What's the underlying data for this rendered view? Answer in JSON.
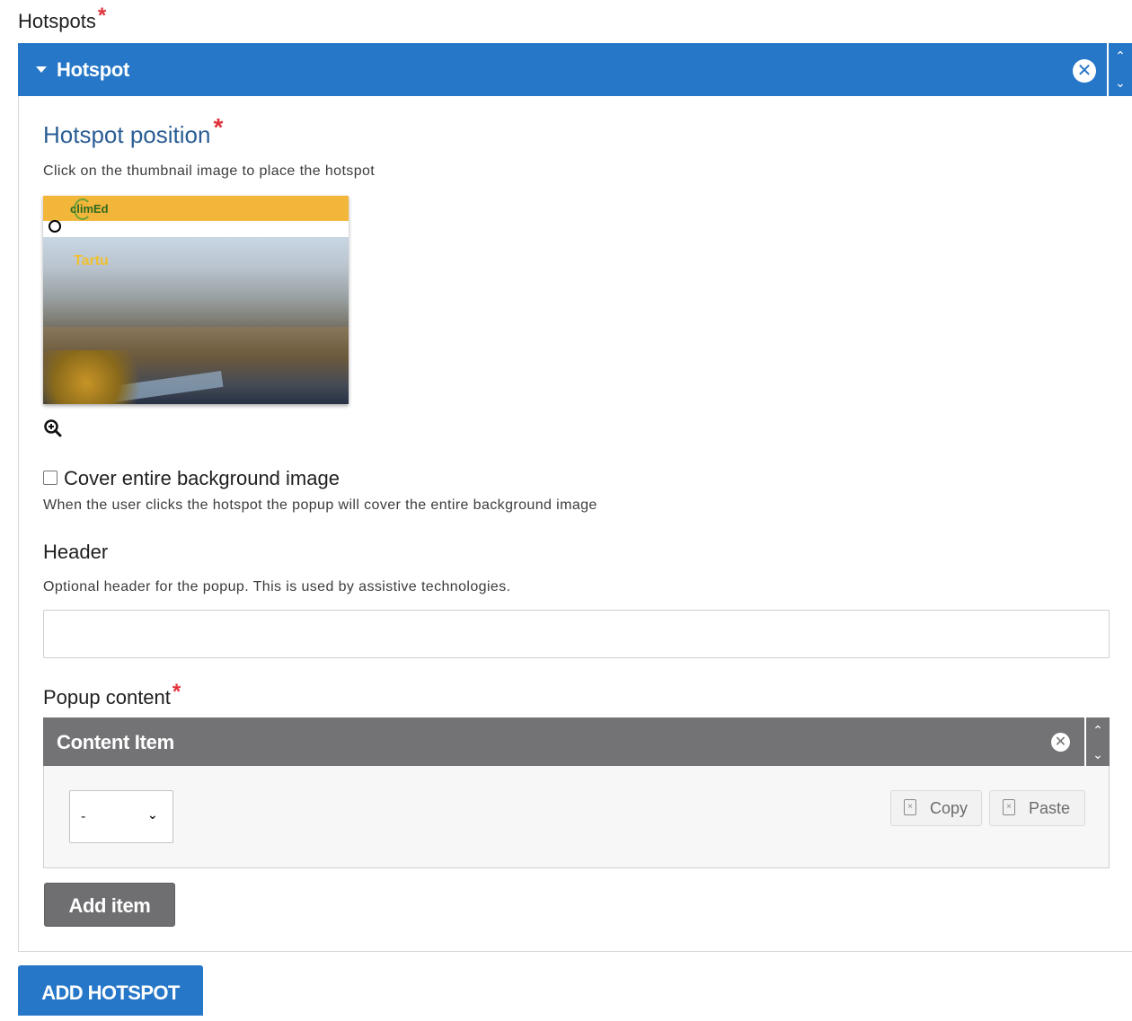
{
  "section_title": "Hotspots",
  "required_marker": "*",
  "hotspot": {
    "label": "Hotspot",
    "close_glyph": "✕",
    "up_glyph": "^",
    "down_glyph": "v"
  },
  "position": {
    "title": "Hotspot position",
    "description": "Click on the thumbnail image to place the hotspot",
    "thumbnail_logo": "climEd",
    "thumbnail_caption": "Tartu"
  },
  "cover": {
    "label": "Cover entire background image",
    "description": "When the user clicks the hotspot the popup will cover the entire background image",
    "checked": false
  },
  "header_field": {
    "label": "Header",
    "description": "Optional header for the popup. This is used by assistive technologies.",
    "value": ""
  },
  "popup_content": {
    "label": "Popup content",
    "item_label": "Content Item",
    "select_value": "-",
    "copy_label": "Copy",
    "paste_label": "Paste",
    "add_item_label": "Add item"
  },
  "add_hotspot_label": "ADD HOTSPOT",
  "colors": {
    "accent": "#2677c8",
    "required": "#e0323c",
    "item_bar": "#737275"
  },
  "icons": [
    "caret-down-icon",
    "close-circle-icon",
    "chevron-up-icon",
    "chevron-down-icon",
    "zoom-in-icon",
    "copy-icon",
    "paste-icon"
  ]
}
